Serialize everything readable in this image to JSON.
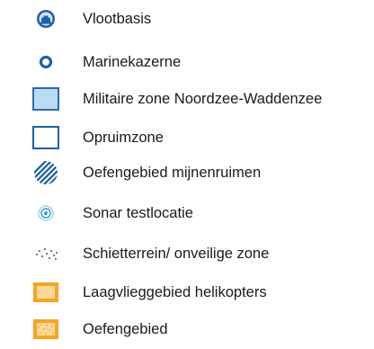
{
  "legend": {
    "items": [
      {
        "icon": "fleet-base-icon",
        "label": "Vlootbasis"
      },
      {
        "icon": "navy-barracks-icon",
        "label": "Marinekazerne"
      },
      {
        "icon": "military-zone-icon",
        "label": "Militaire zone Noordzee-Waddenzee"
      },
      {
        "icon": "clearance-zone-icon",
        "label": "Opruimzone"
      },
      {
        "icon": "mine-clearing-area-icon",
        "label": "Oefengebied mijnenruimen"
      },
      {
        "icon": "sonar-test-site-icon",
        "label": "Sonar testlocatie"
      },
      {
        "icon": "firing-range-icon",
        "label": "Schietterrein/ onveilige zone"
      },
      {
        "icon": "low-flying-area-icon",
        "label": "Laagvlieggebied helikopters"
      },
      {
        "icon": "training-area-icon",
        "label": "Oefengebied"
      }
    ],
    "colors": {
      "navy_blue": "#1f5fa8",
      "zone_fill": "#b9dcf3",
      "zone_border": "#2b6cb0",
      "sonar": "#3b9bdc",
      "orange": "#f5a623",
      "light_orange": "#fcd89a",
      "text": "#1a1a1a"
    }
  }
}
